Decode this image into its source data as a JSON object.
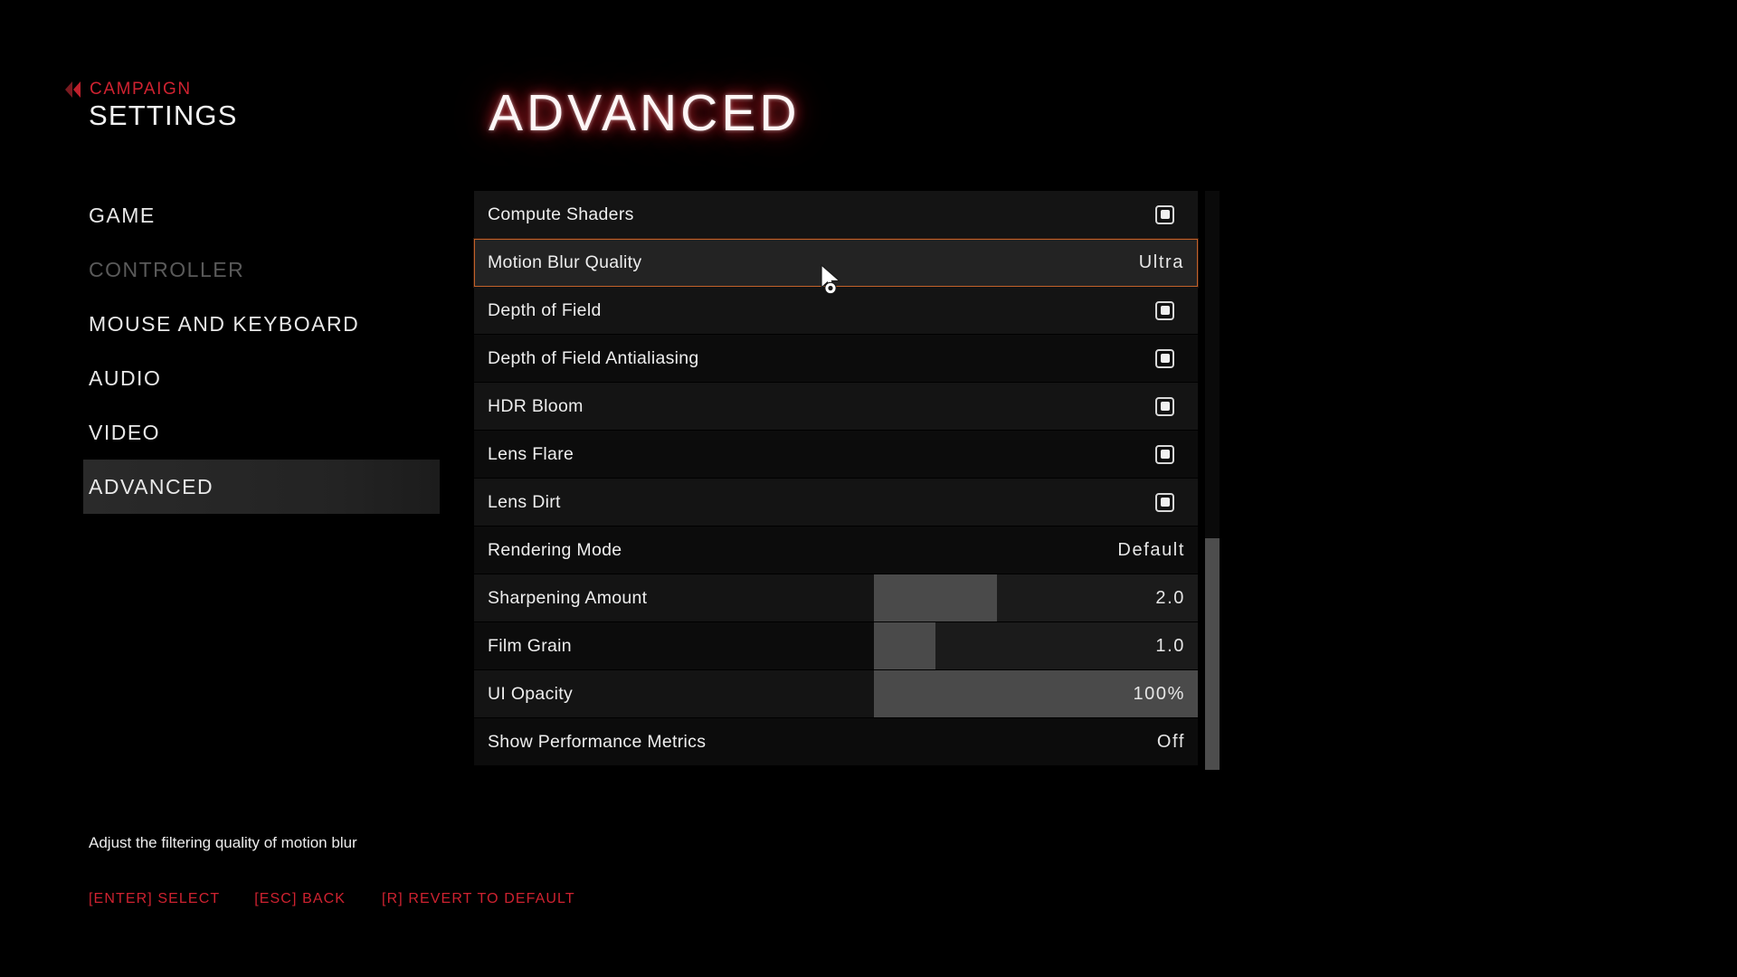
{
  "breadcrumb": {
    "label": "CAMPAIGN",
    "back_icon": "double-chevron-left-icon"
  },
  "screen_title": "SETTINGS",
  "page_title": "ADVANCED",
  "sidebar": {
    "items": [
      {
        "label": "GAME",
        "state": "normal"
      },
      {
        "label": "CONTROLLER",
        "state": "disabled"
      },
      {
        "label": "MOUSE AND KEYBOARD",
        "state": "normal"
      },
      {
        "label": "AUDIO",
        "state": "normal"
      },
      {
        "label": "VIDEO",
        "state": "normal"
      },
      {
        "label": "ADVANCED",
        "state": "active"
      }
    ]
  },
  "settings": {
    "rows": [
      {
        "label": "Compute Shaders",
        "control": "checkbox",
        "checked": true,
        "value": ""
      },
      {
        "label": "Motion Blur Quality",
        "control": "value",
        "checked": false,
        "value": "Ultra",
        "selected": true
      },
      {
        "label": "Depth of Field",
        "control": "checkbox",
        "checked": true,
        "value": ""
      },
      {
        "label": "Depth of Field Antialiasing",
        "control": "checkbox",
        "checked": true,
        "value": ""
      },
      {
        "label": "HDR Bloom",
        "control": "checkbox",
        "checked": true,
        "value": ""
      },
      {
        "label": "Lens Flare",
        "control": "checkbox",
        "checked": true,
        "value": ""
      },
      {
        "label": "Lens Dirt",
        "control": "checkbox",
        "checked": true,
        "value": ""
      },
      {
        "label": "Rendering Mode",
        "control": "value",
        "checked": false,
        "value": "Default"
      },
      {
        "label": "Sharpening Amount",
        "control": "slider",
        "checked": false,
        "value": "2.0",
        "fill_percent": 38
      },
      {
        "label": "Film Grain",
        "control": "slider",
        "checked": false,
        "value": "1.0",
        "fill_percent": 19
      },
      {
        "label": "UI Opacity",
        "control": "slider",
        "checked": false,
        "value": "100%",
        "fill_percent": 100
      },
      {
        "label": "Show Performance Metrics",
        "control": "value",
        "checked": false,
        "value": "Off"
      }
    ],
    "scrollbar": {
      "thumb_top_percent": 60,
      "thumb_height_percent": 40
    }
  },
  "help_text": "Adjust the filtering quality of motion blur",
  "key_hints": [
    {
      "key": "[ENTER]",
      "action": "SELECT"
    },
    {
      "key": "[ESC]",
      "action": "BACK"
    },
    {
      "key": "[R]",
      "action": "REVERT TO DEFAULT"
    }
  ],
  "colors": {
    "accent_red": "#cf2230",
    "selection_border": "#c2612a",
    "text_primary": "#eeeeee",
    "text_disabled": "#5a5a5a"
  },
  "cursor": {
    "icon": "arrow-cursor-icon"
  }
}
